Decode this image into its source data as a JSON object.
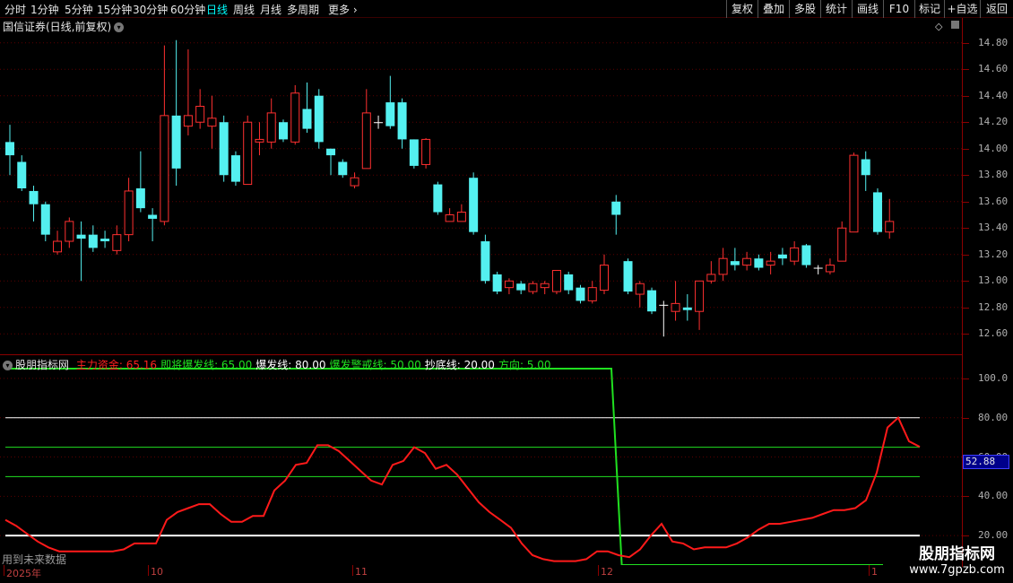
{
  "toolbar": {
    "timeframes": [
      "分时",
      "1分钟",
      "5分钟",
      "15分钟",
      "30分钟",
      "60分钟",
      "日线",
      "周线",
      "月线",
      "多周期",
      "更多"
    ],
    "more_arrow": "›",
    "active": "日线",
    "right_buttons": [
      "复权",
      "叠加",
      "多股",
      "统计",
      "画线",
      "F10",
      "标记",
      "+自选",
      "返回"
    ]
  },
  "main_title": "国信证券(日线,前复权)",
  "indicator": {
    "name": "股朋指标网",
    "items": [
      {
        "label": "主力资金:",
        "value": "65.16",
        "color": "#ff2020"
      },
      {
        "label": "即将爆发线:",
        "value": "65.00",
        "color": "#20e020"
      },
      {
        "label": "爆发线:",
        "value": "80.00",
        "color": "#ffffff"
      },
      {
        "label": "爆发警戒线:",
        "value": "50.00",
        "color": "#20e020"
      },
      {
        "label": "抄底线:",
        "value": "20.00",
        "color": "#ffffff"
      },
      {
        "label": "方向:",
        "value": "5.00",
        "color": "#20e020"
      }
    ],
    "current_tag": "52.88"
  },
  "future_note": "用到未来数据",
  "watermark": {
    "title": "股朋指标网",
    "url": "www.7gpzb.com"
  },
  "x_labels": [
    "2025年",
    "10",
    "11",
    "12",
    "1"
  ],
  "colors": {
    "up": "#ff3030",
    "down": "#54f0f0",
    "cross": "#ffffff",
    "main_line": "#ff1a1a",
    "green_line": "#20e020",
    "white_line": "#ffffff"
  },
  "chart_data": [
    {
      "type": "candlestick",
      "title": "国信证券(日线,前复权)",
      "y_ticks": [
        "14.80",
        "14.60",
        "14.40",
        "14.20",
        "14.00",
        "13.80",
        "13.60",
        "13.40",
        "13.20",
        "13.00",
        "12.80",
        "12.60"
      ],
      "ylim": [
        12.48,
        14.92
      ],
      "candles": [
        [
          14.05,
          13.95,
          14.18,
          13.8
        ],
        [
          13.9,
          13.7,
          13.95,
          13.68
        ],
        [
          13.68,
          13.58,
          13.72,
          13.45
        ],
        [
          13.58,
          13.35,
          13.6,
          13.3
        ],
        [
          13.22,
          13.3,
          13.38,
          13.2
        ],
        [
          13.3,
          13.45,
          13.48,
          13.25
        ],
        [
          13.35,
          13.32,
          13.45,
          13.0
        ],
        [
          13.35,
          13.25,
          13.42,
          13.22
        ],
        [
          13.32,
          13.3,
          13.38,
          13.25
        ],
        [
          13.23,
          13.35,
          13.42,
          13.2
        ],
        [
          13.35,
          13.68,
          13.78,
          13.3
        ],
        [
          13.7,
          13.55,
          13.98,
          13.52
        ],
        [
          13.5,
          13.47,
          13.55,
          13.3
        ],
        [
          13.45,
          14.25,
          14.78,
          13.42
        ],
        [
          14.25,
          13.85,
          14.82,
          13.72
        ],
        [
          14.17,
          14.25,
          14.75,
          14.1
        ],
        [
          14.2,
          14.32,
          14.45,
          14.15
        ],
        [
          14.17,
          14.23,
          14.4,
          14.0
        ],
        [
          14.2,
          13.8,
          14.25,
          13.75
        ],
        [
          13.95,
          13.75,
          13.98,
          13.72
        ],
        [
          13.73,
          14.2,
          14.25,
          13.73
        ],
        [
          14.05,
          14.07,
          14.2,
          13.95
        ],
        [
          14.05,
          14.27,
          14.38,
          14.0
        ],
        [
          14.2,
          14.07,
          14.22,
          14.05
        ],
        [
          14.05,
          14.42,
          14.48,
          14.03
        ],
        [
          14.3,
          14.15,
          14.5,
          14.12
        ],
        [
          14.4,
          14.05,
          14.45,
          14.0
        ],
        [
          14.0,
          13.95,
          14.0,
          13.8
        ],
        [
          13.9,
          13.8,
          13.92,
          13.78
        ],
        [
          13.72,
          13.78,
          13.82,
          13.7
        ],
        [
          13.85,
          14.27,
          14.45,
          13.85
        ],
        [
          14.2,
          14.2,
          14.25,
          14.15
        ],
        [
          14.35,
          14.17,
          14.55,
          14.15
        ],
        [
          14.35,
          14.07,
          14.38,
          14.0
        ],
        [
          14.07,
          13.87,
          14.07,
          13.85
        ],
        [
          13.88,
          14.07,
          14.08,
          13.85
        ],
        [
          13.73,
          13.52,
          13.75,
          13.5
        ],
        [
          13.45,
          13.5,
          13.55,
          13.45
        ],
        [
          13.45,
          13.52,
          13.58,
          13.45
        ],
        [
          13.78,
          13.37,
          13.82,
          13.35
        ],
        [
          13.3,
          13.0,
          13.35,
          12.98
        ],
        [
          13.05,
          12.92,
          13.07,
          12.9
        ],
        [
          12.95,
          13.0,
          13.02,
          12.9
        ],
        [
          12.98,
          12.93,
          13.0,
          12.9
        ],
        [
          12.92,
          12.98,
          13.0,
          12.9
        ],
        [
          12.95,
          12.98,
          13.0,
          12.9
        ],
        [
          12.92,
          13.08,
          13.08,
          12.9
        ],
        [
          13.05,
          12.93,
          13.07,
          12.9
        ],
        [
          12.95,
          12.85,
          12.97,
          12.83
        ],
        [
          12.85,
          12.95,
          13.0,
          12.83
        ],
        [
          12.93,
          13.12,
          13.2,
          12.9
        ],
        [
          13.6,
          13.5,
          13.65,
          13.35
        ],
        [
          13.15,
          12.92,
          13.17,
          12.9
        ],
        [
          12.9,
          12.98,
          13.0,
          12.8
        ],
        [
          12.93,
          12.77,
          12.95,
          12.75
        ],
        [
          12.82,
          12.82,
          12.85,
          12.58
        ],
        [
          12.77,
          12.83,
          13.0,
          12.7
        ],
        [
          12.8,
          12.78,
          12.9,
          12.7
        ],
        [
          12.77,
          13.0,
          13.0,
          12.63
        ],
        [
          13.0,
          13.05,
          13.15,
          12.98
        ],
        [
          13.05,
          13.17,
          13.25,
          13.0
        ],
        [
          13.15,
          13.12,
          13.25,
          13.08
        ],
        [
          13.12,
          13.17,
          13.22,
          13.08
        ],
        [
          13.17,
          13.1,
          13.2,
          13.08
        ],
        [
          13.12,
          13.15,
          13.22,
          13.05
        ],
        [
          13.2,
          13.17,
          13.25,
          13.12
        ],
        [
          13.15,
          13.25,
          13.3,
          13.12
        ],
        [
          13.27,
          13.12,
          13.28,
          13.1
        ],
        [
          13.1,
          13.1,
          13.12,
          13.05
        ],
        [
          13.07,
          13.12,
          13.17,
          13.05
        ],
        [
          13.15,
          13.4,
          13.45,
          13.15
        ],
        [
          13.37,
          13.95,
          13.97,
          13.37
        ],
        [
          13.92,
          13.8,
          13.98,
          13.68
        ],
        [
          13.67,
          13.37,
          13.7,
          13.35
        ],
        [
          13.37,
          13.45,
          13.62,
          13.32
        ]
      ]
    },
    {
      "type": "line",
      "title": "股朋指标网",
      "y_ticks": [
        "100.0",
        "80.00",
        "60.00",
        "40.00",
        "20.00"
      ],
      "ylim": [
        5,
        110
      ],
      "series": [
        {
          "name": "主力资金",
          "values": [
            28,
            25,
            21,
            17,
            14,
            12,
            12,
            12,
            12,
            12,
            12,
            13,
            16,
            16,
            16,
            28,
            32,
            34,
            36,
            36,
            31,
            27,
            27,
            30,
            30,
            43,
            48,
            56,
            57,
            66,
            66,
            63,
            58,
            53,
            48,
            46,
            56,
            58,
            65,
            62,
            54,
            56,
            51,
            44,
            37,
            32,
            28,
            24,
            16,
            10,
            8,
            7,
            7,
            7,
            8,
            12,
            12,
            10,
            9,
            13,
            20,
            26,
            17,
            16,
            13,
            14,
            14,
            14,
            16,
            19,
            23,
            26,
            26,
            27,
            28,
            29,
            31,
            33,
            33,
            34,
            38,
            52,
            75,
            80,
            68,
            65.16
          ]
        },
        {
          "name": "即将爆发线",
          "values": [
            65
          ]
        },
        {
          "name": "爆发线",
          "values": [
            80
          ]
        },
        {
          "name": "爆发警戒线",
          "values": [
            50
          ]
        },
        {
          "name": "抄底线",
          "values": [
            20
          ]
        },
        {
          "name": "方向",
          "values": [
            105,
            105,
            105,
            105,
            105,
            105,
            105,
            105,
            105,
            105,
            105,
            105,
            105,
            105,
            105,
            105,
            105,
            105,
            105,
            105,
            105,
            105,
            105,
            105,
            105,
            105,
            105,
            105,
            105,
            105,
            105,
            105,
            105,
            105,
            105,
            105,
            105,
            105,
            105,
            105,
            105,
            105,
            105,
            105,
            105,
            105,
            105,
            105,
            105,
            105,
            105,
            105,
            105,
            105,
            105,
            105,
            105,
            105,
            105,
            5,
            5,
            5,
            5,
            5,
            5,
            5,
            5,
            5,
            5,
            5,
            5,
            5,
            5,
            5,
            5,
            5,
            5,
            5,
            5,
            5,
            5,
            5,
            5,
            5,
            5
          ]
        }
      ]
    }
  ]
}
